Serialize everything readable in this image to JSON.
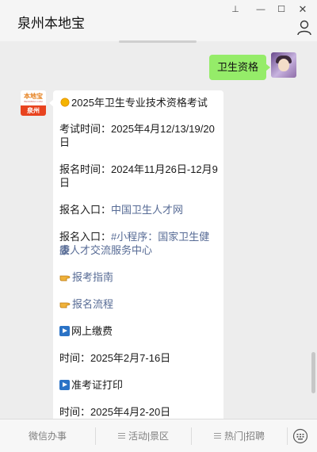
{
  "window": {
    "title": "泉州本地宝",
    "buttons": {
      "pin": "⊥",
      "minimize": "—",
      "maximize": "☐",
      "close": "✕"
    }
  },
  "outgoing": {
    "text": "卫生资格"
  },
  "brand_avatar": {
    "name": "本地宝",
    "subtitle": "BENDIBAO.COM",
    "city": "泉州"
  },
  "message": {
    "title": "2025年卫生专业技术资格考试",
    "exam_time_line1": "考试时间：2025年4月12/13/19/20",
    "exam_time_line2": "日",
    "reg_time_line1": "报名时间：2024年11月26日-12月9",
    "reg_time_line2": "日",
    "entry1_prefix": "报名入口：",
    "entry1_link": "中国卫生人才网",
    "entry2_prefix": "报名入口：",
    "entry2_link_line1": "#小程序：国家卫生健康",
    "entry2_link_line2": "委人才交流服务中心",
    "guide_link": "报考指南",
    "process_link": "报名流程",
    "payment_title": "网上缴费",
    "payment_time": "时间：2025年2月7-16日",
    "admit_title": "准考证打印",
    "admit_time": "时间：2025年4月2-20日"
  },
  "menu": {
    "item1": "微信办事",
    "item2": "活动|景区",
    "item3": "热门|招聘"
  },
  "colors": {
    "bubble_out": "#95ec69",
    "link": "#576b95",
    "brand_orange": "#e8431f"
  },
  "icons": [
    "pin-icon",
    "minimize-icon",
    "maximize-icon",
    "close-icon",
    "person-icon",
    "sun-emoji-icon",
    "pointing-hand-icon",
    "play-button-icon",
    "keyboard-icon"
  ]
}
